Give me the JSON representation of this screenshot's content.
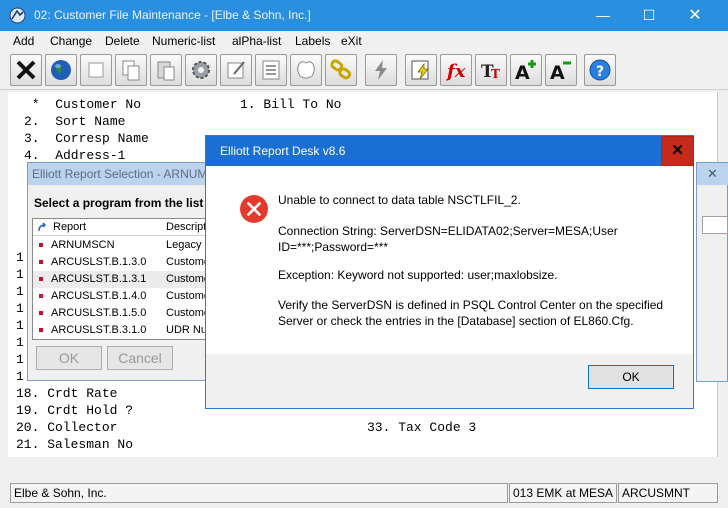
{
  "window": {
    "title": "02: Customer File Maintenance - [Elbe & Sohn, Inc.]",
    "minimize_glyph": "—",
    "maximize_glyph": "☐",
    "close_glyph": "✕"
  },
  "menu": {
    "add": "Add",
    "change": "Change",
    "delete": "Delete",
    "numeric_list": "Numeric-list",
    "alpha_list": "alPha-list",
    "labels": "Labels",
    "exit": "eXit"
  },
  "toolbar": {
    "icons": [
      "exit-icon",
      "globe-icon",
      "blank-icon",
      "copy-icon",
      "paste-icon",
      "gear-icon",
      "edit-form-icon",
      "list-icon",
      "notes-icon",
      "chain-link-icon",
      "lightning-icon",
      "report-lightning-icon",
      "function-icon",
      "font-size-icon",
      "increase-font-icon",
      "decrease-font-icon",
      "help-icon"
    ]
  },
  "screen": {
    "fields": {
      "customer_no": " *  Customer No",
      "bill_to_no": "1. Bill To No",
      "sort_name": "2.  Sort Name",
      "corresp_name": "3.  Corresp Name",
      "address_1": "4.  Address-1",
      "f18": "18. Crdt Rate",
      "f19": "19. Crdt Hold ?",
      "f20": "20. Collector",
      "f21": "21. Salesman No",
      "f33": "33. Tax Code 3"
    },
    "partial_line_digit": "1"
  },
  "status": {
    "company": "Elbe & Sohn, Inc.",
    "user": "013 EMK at MESA",
    "program": "ARCUSMNT"
  },
  "report_selection": {
    "title": "Elliott Report Selection - ARNUM",
    "prompt": "Select a program from the list b",
    "col_report": "Report",
    "col_desc": "Descript",
    "rows": [
      {
        "report": "ARNUMSCN",
        "desc": "Legacy"
      },
      {
        "report": "ARCUSLST.B.1.3.0",
        "desc": "Custome"
      },
      {
        "report": "ARCUSLST.B.1.3.1",
        "desc": "Custome"
      },
      {
        "report": "ARCUSLST.B.1.4.0",
        "desc": "Custome"
      },
      {
        "report": "ARCUSLST.B.1.5.0",
        "desc": "Custome"
      },
      {
        "report": "ARCUSLST.B.3.1.0",
        "desc": "UDR Nu"
      }
    ],
    "ok": "OK",
    "cancel": "Cancel"
  },
  "side_window": {
    "close_glyph": "✕"
  },
  "dialog": {
    "title": "Elliott Report Desk v8.6",
    "close_glyph": "✕",
    "line1": "Unable to connect to data table NSCTLFIL_2.",
    "line2": "Connection String: ServerDSN=ELIDATA02;Server=MESA;User",
    "line3": "ID=***;Password=***",
    "line4": "Exception: Keyword not supported: user;maxlobsize.",
    "line5": "Verify the ServerDSN is defined in PSQL Control Center on the specified",
    "line6": "Server or check the entries in the [Database] section of EL860.Cfg.",
    "ok": "OK"
  }
}
